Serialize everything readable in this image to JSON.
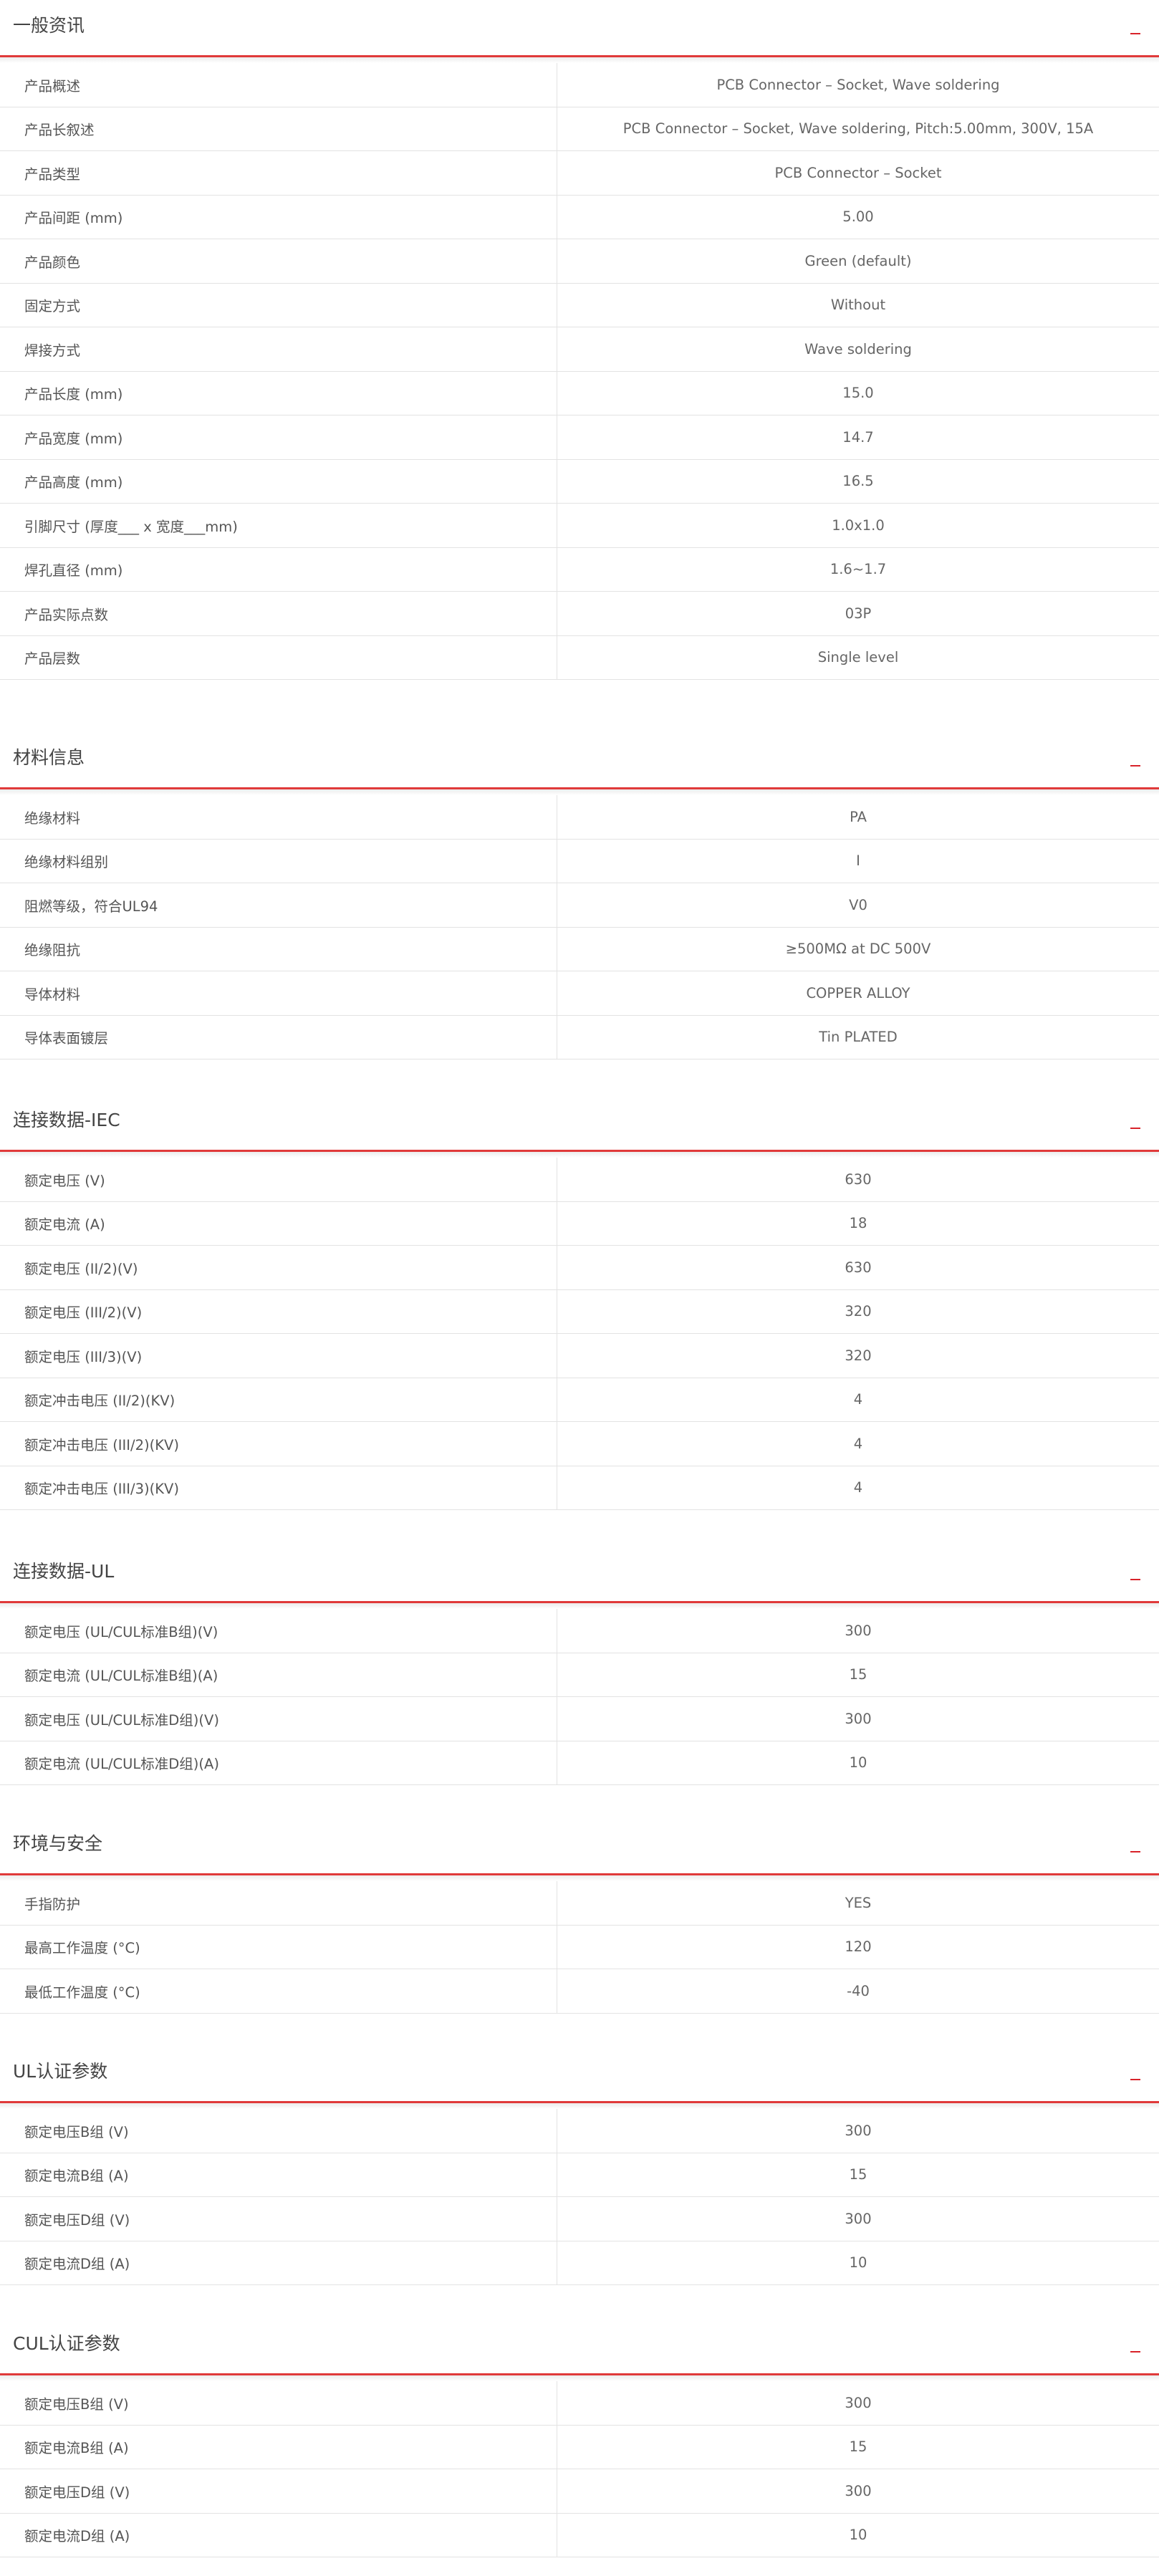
{
  "accent_color": "#e03a3a",
  "collapse_icon": "minus-icon",
  "sections": [
    {
      "title": "一般资讯",
      "rows": [
        {
          "label": "产品概述",
          "value": "PCB Connector – Socket, Wave soldering"
        },
        {
          "label": "产品长叙述",
          "value": "PCB Connector – Socket, Wave soldering, Pitch:5.00mm, 300V, 15A"
        },
        {
          "label": "产品类型",
          "value": "PCB Connector – Socket"
        },
        {
          "label": "产品间距 (mm)",
          "value": "5.00"
        },
        {
          "label": "产品颜色",
          "value": "Green (default)"
        },
        {
          "label": "固定方式",
          "value": "Without"
        },
        {
          "label": "焊接方式",
          "value": "Wave soldering"
        },
        {
          "label": "产品长度 (mm)",
          "value": "15.0"
        },
        {
          "label": "产品宽度 (mm)",
          "value": "14.7"
        },
        {
          "label": "产品高度 (mm)",
          "value": "16.5"
        },
        {
          "label": "引脚尺寸 (厚度___ x 宽度___mm)",
          "value": "1.0x1.0"
        },
        {
          "label": "焊孔直径 (mm)",
          "value": "1.6~1.7"
        },
        {
          "label": "产品实际点数",
          "value": "03P"
        },
        {
          "label": "产品层数",
          "value": "Single level"
        }
      ]
    },
    {
      "title": "材料信息",
      "rows": [
        {
          "label": "绝缘材料",
          "value": "PA"
        },
        {
          "label": "绝缘材料组别",
          "value": "I"
        },
        {
          "label": "阻燃等级，符合UL94",
          "value": "V0"
        },
        {
          "label": "绝缘阻抗",
          "value": "≥500MΩ at DC 500V"
        },
        {
          "label": "导体材料",
          "value": "COPPER ALLOY"
        },
        {
          "label": "导体表面镀层",
          "value": "Tin PLATED"
        }
      ]
    },
    {
      "title": "连接数据-IEC",
      "rows": [
        {
          "label": "额定电压 (V)",
          "value": "630"
        },
        {
          "label": "额定电流 (A)",
          "value": "18"
        },
        {
          "label": "额定电压 (II/2)(V)",
          "value": "630"
        },
        {
          "label": "额定电压 (III/2)(V)",
          "value": "320"
        },
        {
          "label": "额定电压 (III/3)(V)",
          "value": "320"
        },
        {
          "label": "额定冲击电压 (II/2)(KV)",
          "value": "4"
        },
        {
          "label": "额定冲击电压 (III/2)(KV)",
          "value": "4"
        },
        {
          "label": "额定冲击电压 (III/3)(KV)",
          "value": "4"
        }
      ]
    },
    {
      "title": "连接数据-UL",
      "rows": [
        {
          "label": "额定电压 (UL/CUL标准B组)(V)",
          "value": "300"
        },
        {
          "label": "额定电流 (UL/CUL标准B组)(A)",
          "value": "15"
        },
        {
          "label": "额定电压 (UL/CUL标准D组)(V)",
          "value": "300"
        },
        {
          "label": "额定电流 (UL/CUL标准D组)(A)",
          "value": "10"
        }
      ]
    },
    {
      "title": "环境与安全",
      "rows": [
        {
          "label": "手指防护",
          "value": "YES"
        },
        {
          "label": "最高工作温度 (°C)",
          "value": "120"
        },
        {
          "label": "最低工作温度 (°C)",
          "value": "-40"
        }
      ]
    },
    {
      "title": "UL认证参数",
      "rows": [
        {
          "label": "额定电压B组 (V)",
          "value": "300"
        },
        {
          "label": "额定电流B组 (A)",
          "value": "15"
        },
        {
          "label": "额定电压D组 (V)",
          "value": "300"
        },
        {
          "label": "额定电流D组 (A)",
          "value": "10"
        }
      ]
    },
    {
      "title": "CUL认证参数",
      "rows": [
        {
          "label": "额定电压B组 (V)",
          "value": "300"
        },
        {
          "label": "额定电流B组 (A)",
          "value": "15"
        },
        {
          "label": "额定电压D组 (V)",
          "value": "300"
        },
        {
          "label": "额定电流D组 (A)",
          "value": "10"
        }
      ]
    }
  ]
}
